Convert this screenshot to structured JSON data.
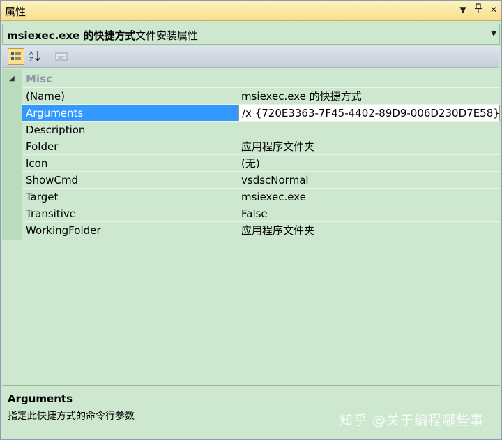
{
  "window": {
    "title": "属性"
  },
  "object_selector": {
    "name": "msiexec.exe 的快捷方式",
    "type": "文件安装属性"
  },
  "toolbar": {
    "buttons": [
      {
        "name": "categorized",
        "icon": "categorized-icon",
        "selected": true
      },
      {
        "name": "alphabetical",
        "icon": "sort-az-icon",
        "selected": false
      },
      {
        "name": "property-pages",
        "icon": "property-pages-icon",
        "selected": false
      }
    ]
  },
  "category": {
    "label": "Misc",
    "expanded": true
  },
  "properties": [
    {
      "name": "(Name)",
      "value": "msiexec.exe 的快捷方式"
    },
    {
      "name": "Arguments",
      "value": "/x {720E3363-7F45-4402-89D9-006D230D7E58}"
    },
    {
      "name": "Description",
      "value": ""
    },
    {
      "name": "Folder",
      "value": "应用程序文件夹"
    },
    {
      "name": "Icon",
      "value": "(无)"
    },
    {
      "name": "ShowCmd",
      "value": "vsdscNormal"
    },
    {
      "name": "Target",
      "value": "msiexec.exe"
    },
    {
      "name": "Transitive",
      "value": "False"
    },
    {
      "name": "WorkingFolder",
      "value": "应用程序文件夹"
    }
  ],
  "selected_property": "Arguments",
  "description": {
    "title": "Arguments",
    "text": "指定此快捷方式的命令行参数"
  },
  "watermark": "知乎 @关于编程哪些事",
  "colors": {
    "grid_background": "#cde8cf",
    "selection": "#3399ff",
    "titlebar": "#f6df8a"
  }
}
